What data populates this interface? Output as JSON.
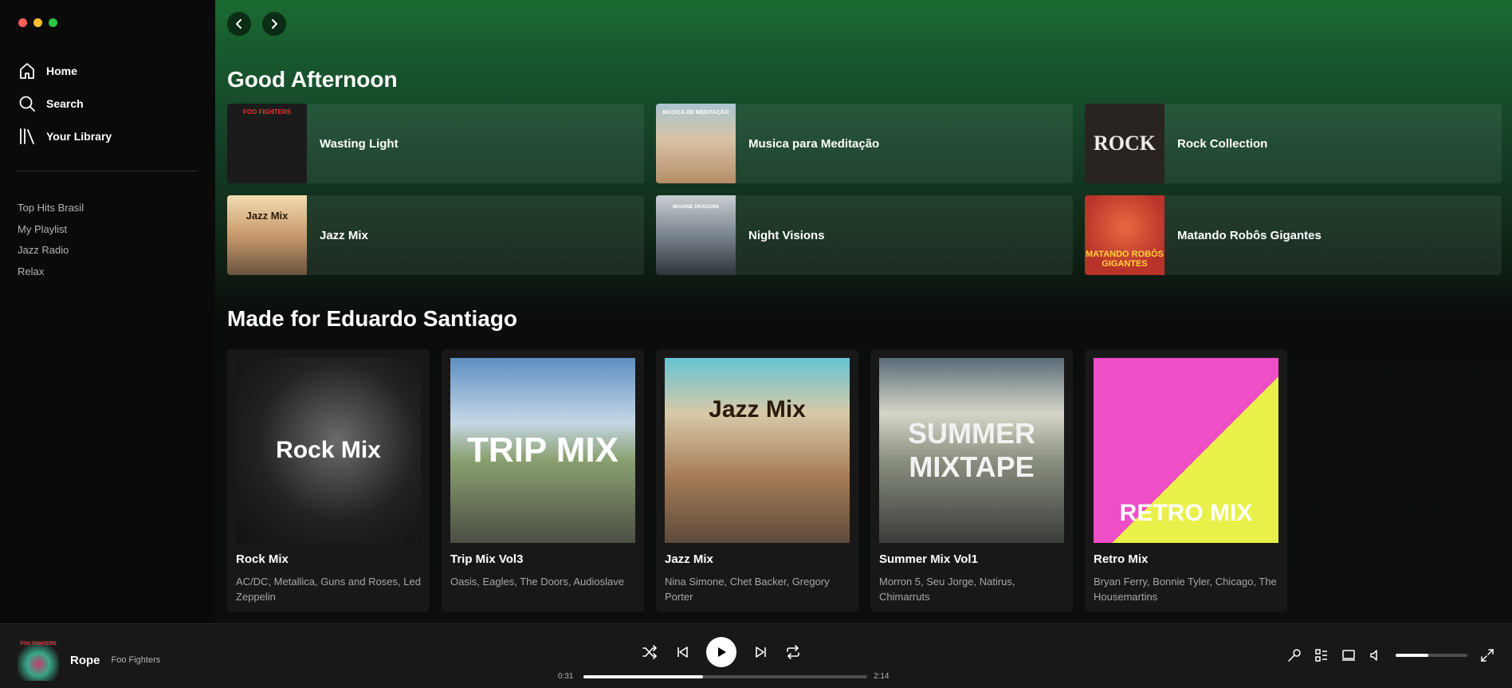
{
  "window": {
    "controls": [
      "#ff5f57",
      "#febc2e",
      "#28c840"
    ]
  },
  "sidebar": {
    "nav": [
      {
        "label": "Home",
        "icon": "home-icon"
      },
      {
        "label": "Search",
        "icon": "search-icon"
      },
      {
        "label": "Your Library",
        "icon": "library-icon"
      }
    ],
    "playlists": [
      "Top Hits Brasil",
      "My Playlist",
      "Jazz Radio",
      "Relax"
    ]
  },
  "main": {
    "greeting": "Good Afternoon",
    "quick_picks": [
      {
        "title": "Wasting Light",
        "cover_text": "FOO FIGHTERS",
        "cover_color": "#1b1b1b"
      },
      {
        "title": "Musica para Meditação",
        "cover_text": "MÚSICA DE MEDITAÇÃO",
        "cover_color": "#c9a27a"
      },
      {
        "title": "Rock Collection",
        "cover_text": "ROCK",
        "cover_color": "#2a2420"
      },
      {
        "title": "Jazz Mix",
        "cover_text": "Jazz Mix",
        "cover_color": "#b88a5e"
      },
      {
        "title": "Night Visions",
        "cover_text": "IMAGINE DRAGONS",
        "cover_color": "#4c5560"
      },
      {
        "title": "Matando Robôs Gigantes",
        "cover_text": "MATANDO ROBÔS GIGANTES",
        "cover_color": "#c2442f"
      }
    ],
    "made_for_title": "Made for Eduardo Santiago",
    "mixes": [
      {
        "title": "Rock Mix",
        "desc": "AC/DC, Metallica, Guns and Roses, Led Zeppelin",
        "cover_text": "Rock Mix",
        "cover_color": "#1c1c1c"
      },
      {
        "title": "Trip Mix Vol3",
        "desc": "Oasis, Eagles, The Doors, Audioslave",
        "cover_text": "TRIP MIX",
        "cover_color": "#6a8f5b"
      },
      {
        "title": "Jazz Mix",
        "desc": "Nina Simone, Chet Backer, Gregory Porter",
        "cover_text": "Jazz Mix",
        "cover_color": "#c9a07a"
      },
      {
        "title": "Summer Mix Vol1",
        "desc": "Morron 5, Seu Jorge, Natirus, Chimarruts",
        "cover_text": "SUMMER MIXTAPE",
        "cover_color": "#7d8a8a"
      },
      {
        "title": "Retro Mix",
        "desc": "Bryan Ferry, Bonnie Tyler, Chicago, The Housemartins",
        "cover_text": "RETRO MIX",
        "cover_color": "#ee4ec8"
      }
    ]
  },
  "player": {
    "track": "Rope",
    "artist": "Foo Fighters",
    "cover_text": "FOO FIGHTERS",
    "elapsed": "0:31",
    "duration": "2:14",
    "progress_fraction": 0.42,
    "volume_fraction": 0.45
  }
}
